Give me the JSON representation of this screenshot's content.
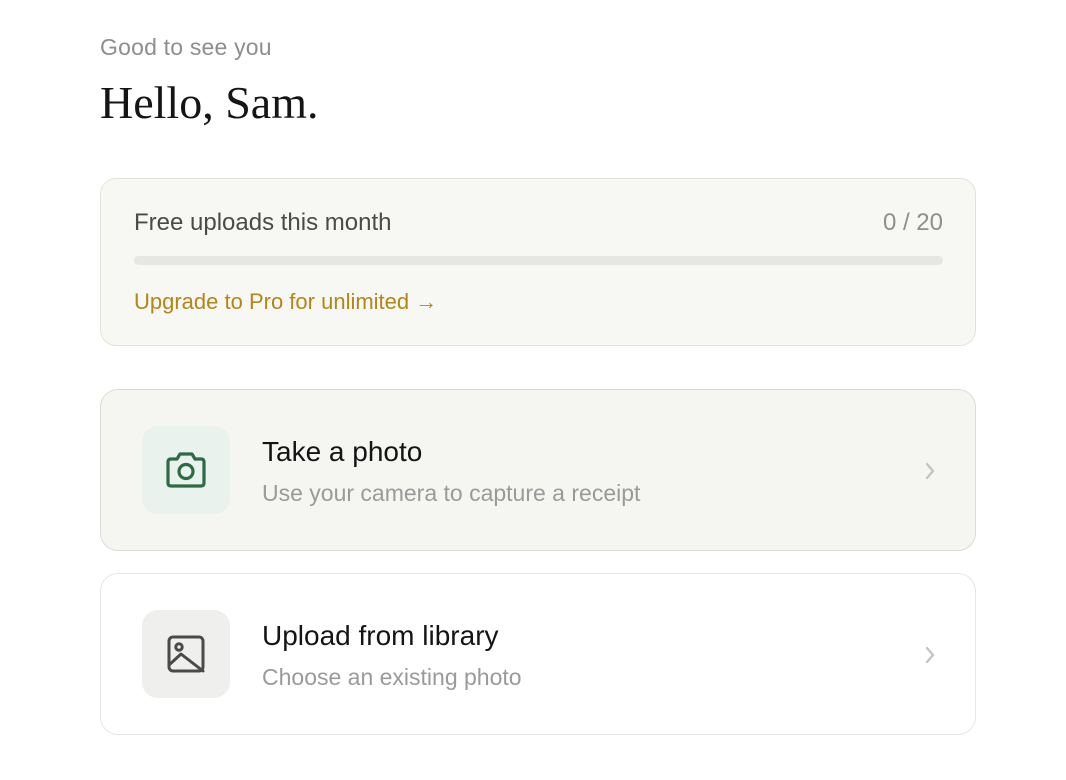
{
  "greeting": {
    "subtitle": "Good to see you",
    "title": "Hello, Sam."
  },
  "quota": {
    "label": "Free uploads this month",
    "count": "0 / 20",
    "used": 0,
    "limit": 20,
    "upgrade_link": "Upgrade to Pro for unlimited →",
    "accent_color": "#b38618"
  },
  "actions": [
    {
      "title": "Take a photo",
      "description": "Use your camera to capture a receipt",
      "icon": "camera-icon",
      "icon_color": "#2e6b45"
    },
    {
      "title": "Upload from library",
      "description": "Choose an existing photo",
      "icon": "image-icon",
      "icon_color": "#4a4a4a"
    }
  ]
}
